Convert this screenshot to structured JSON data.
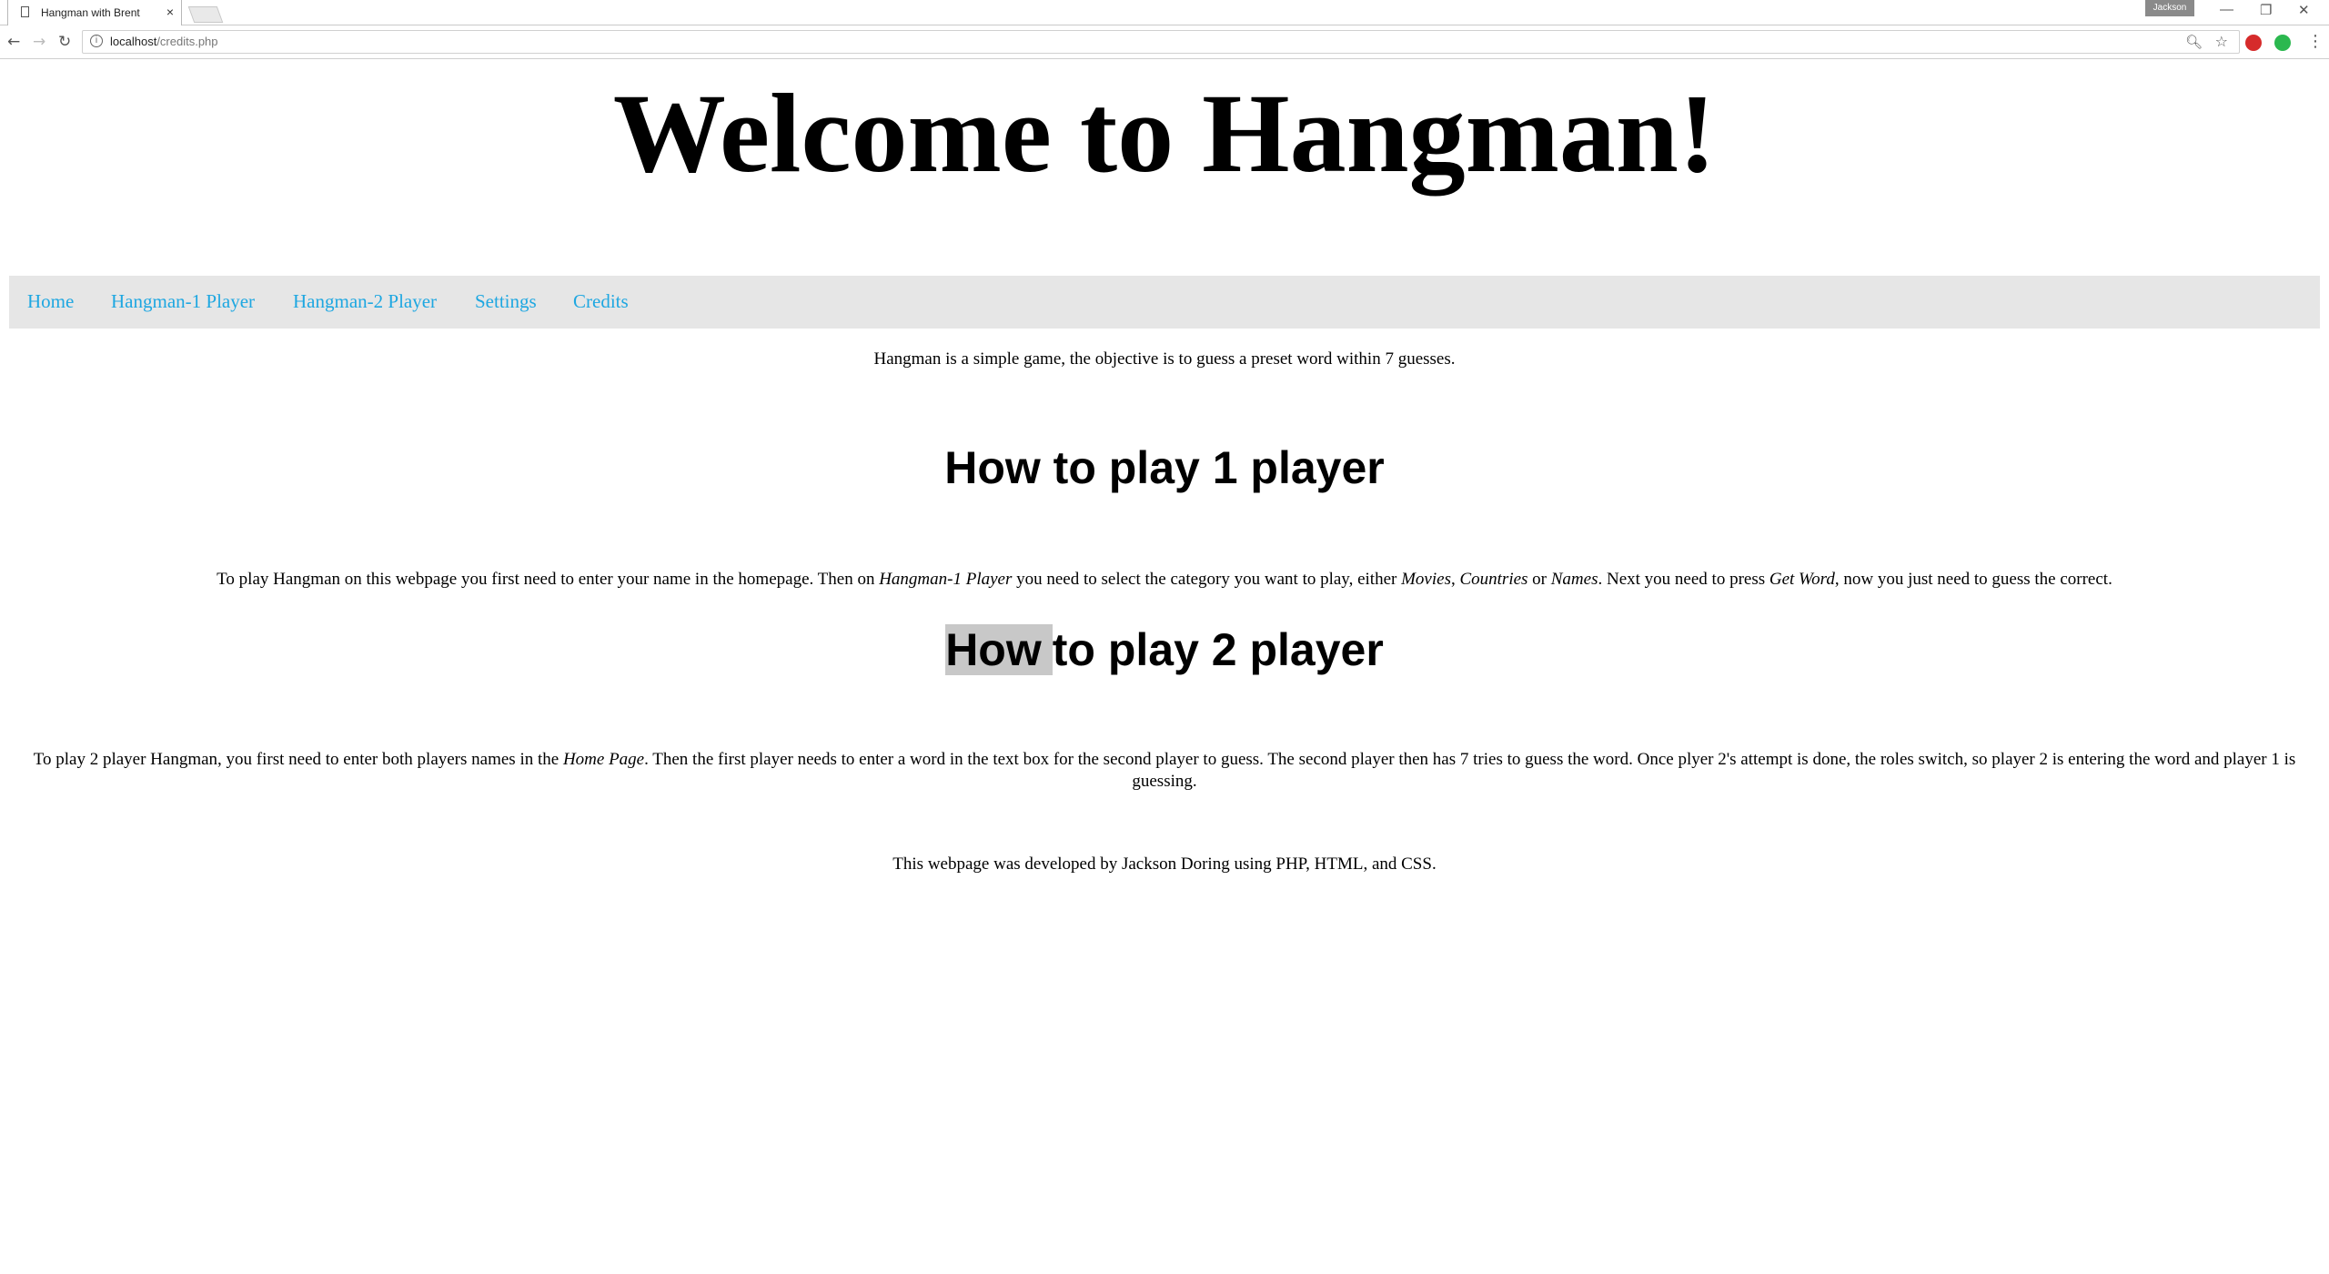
{
  "browser": {
    "tab_title": "Hangman with Brent",
    "tab_close": "×",
    "profile_label": "Jackson",
    "window_controls": {
      "minimize": "—",
      "restore": "❐",
      "close": "✕"
    },
    "url_host": "localhost",
    "url_path": "/credits.php",
    "icons": [
      "back-icon",
      "forward-icon",
      "reload-icon",
      "info-icon",
      "zoom-icon",
      "star-icon",
      "extension-red-icon",
      "extension-green-icon",
      "menu-icon"
    ]
  },
  "header": {
    "title": "Welcome to Hangman!"
  },
  "nav": {
    "items": [
      {
        "label": "Home"
      },
      {
        "label": "Hangman-1 Player"
      },
      {
        "label": "Hangman-2 Player"
      },
      {
        "label": "Settings"
      },
      {
        "label": "Credits"
      }
    ],
    "link_color": "#1ea7e1",
    "background": "#e6e6e6"
  },
  "intro": "Hangman is a simple game, the objective is to guess a preset word within 7 guesses.",
  "section1": {
    "heading": "How to play 1 player",
    "text_a": "To play Hangman on this webpage you first need to enter your name in the homepage. Then on ",
    "em_a": "Hangman-1 Player",
    "text_b": " you need to select the category you want to play, either ",
    "em_b": "Movies",
    "text_c": ", ",
    "em_c": "Countries",
    "text_d": " or ",
    "em_d": "Names",
    "text_e": ". Next you need to press ",
    "em_e": "Get Word",
    "text_f": ", now you just need to guess the correct."
  },
  "section2": {
    "heading_highlight": "How",
    "heading_rest": "to play 2 player",
    "text_a": "To play 2 player Hangman, you first need to enter both players names in the ",
    "em_a": "Home Page",
    "text_b": ". Then the first player needs to enter a word in the text box for the second player to guess. The second player then has 7 tries to guess the word. Once plyer 2's attempt is done, the roles switch, so player 2 is entering the word and player 1 is guessing."
  },
  "footer": {
    "credit": "This webpage was developed by Jackson Doring using PHP, HTML, and CSS."
  }
}
